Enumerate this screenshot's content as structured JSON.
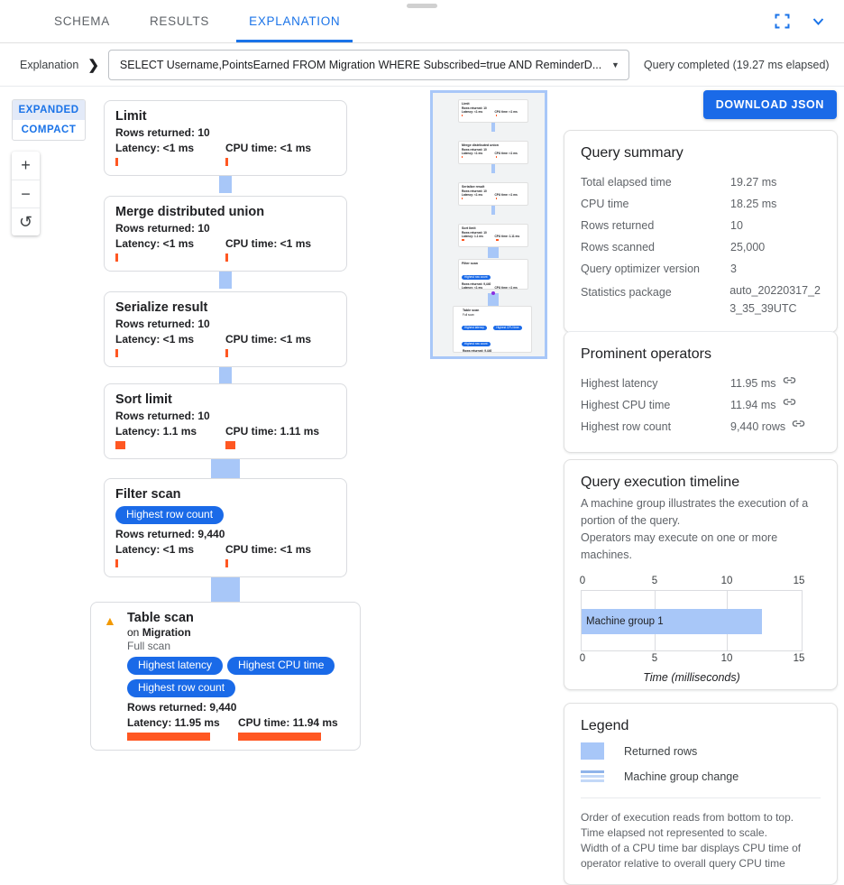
{
  "window": {
    "drag_handle": "drag-handle"
  },
  "tabs": [
    {
      "label": "SCHEMA",
      "active": false
    },
    {
      "label": "RESULTS",
      "active": false
    },
    {
      "label": "EXPLANATION",
      "active": true
    }
  ],
  "tabbar_actions": [
    {
      "name": "fullscreen-icon",
      "glyph": "fullscreen"
    },
    {
      "name": "chevron-down-icon",
      "glyph": "chevron-down"
    }
  ],
  "breadcrumb": {
    "label": "Explanation",
    "separator": "❯",
    "query": "SELECT Username,PointsEarned FROM Migration WHERE Subscribed=true AND ReminderD...",
    "caret": "▼",
    "status": "Query completed (19.27 ms elapsed)"
  },
  "view_mode": {
    "options": [
      {
        "label": "EXPANDED",
        "selected": true
      },
      {
        "label": "COMPACT",
        "selected": false
      }
    ]
  },
  "zoom_controls": [
    {
      "name": "zoom-in-button",
      "glyph": "+"
    },
    {
      "name": "zoom-out-button",
      "glyph": "−"
    },
    {
      "name": "reset-view-button",
      "glyph": "↺"
    }
  ],
  "download_button": {
    "label": "DOWNLOAD JSON"
  },
  "graph": {
    "nodes": [
      {
        "title": "Limit",
        "rows_label": "Rows returned: 10",
        "latency_label": "Latency: <1 ms",
        "cpu_label": "CPU time: <1 ms",
        "latency_bar_width": 3,
        "cpu_bar_width": 3,
        "badges": [],
        "warning": false
      },
      {
        "title": "Merge distributed union",
        "rows_label": "Rows returned: 10",
        "latency_label": "Latency: <1 ms",
        "cpu_label": "CPU time: <1 ms",
        "latency_bar_width": 3,
        "cpu_bar_width": 3,
        "badges": [],
        "warning": false
      },
      {
        "title": "Serialize result",
        "rows_label": "Rows returned: 10",
        "latency_label": "Latency: <1 ms",
        "cpu_label": "CPU time: <1 ms",
        "latency_bar_width": 3,
        "cpu_bar_width": 3,
        "badges": [],
        "warning": false
      },
      {
        "title": "Sort limit",
        "rows_label": "Rows returned: 10",
        "latency_label": "Latency: 1.1 ms",
        "cpu_label": "CPU time: 1.11 ms",
        "latency_bar_width": 11,
        "cpu_bar_width": 11,
        "badges": [],
        "warning": false
      },
      {
        "title": "Filter scan",
        "rows_label": "Rows returned: 9,440",
        "latency_label": "Latency: <1 ms",
        "cpu_label": "CPU time: <1 ms",
        "latency_bar_width": 3,
        "cpu_bar_width": 3,
        "badges": [
          "Highest row count"
        ],
        "warning": false
      },
      {
        "title": "Table scan",
        "subtitle_prefix": "on ",
        "subtitle_target": "Migration",
        "scan_type": "Full scan",
        "rows_label": "Rows returned: 9,440",
        "latency_label": "Latency: 11.95 ms",
        "cpu_label": "CPU time: 11.94 ms",
        "latency_bar_width": 92,
        "cpu_bar_width": 92,
        "badges": [
          "Highest latency",
          "Highest CPU time",
          "Highest row count"
        ],
        "warning": true
      }
    ],
    "edges": [
      {
        "from": "Limit",
        "to": "Merge distributed union",
        "width": 14,
        "machine_group_change": false
      },
      {
        "from": "Merge distributed union",
        "to": "Serialize result",
        "width": 14,
        "machine_group_change": false
      },
      {
        "from": "Serialize result",
        "to": "Sort limit",
        "width": 14,
        "machine_group_change": false
      },
      {
        "from": "Sort limit",
        "to": "Filter scan",
        "width": 32,
        "machine_group_change": true
      },
      {
        "from": "Filter scan",
        "to": "Table scan",
        "width": 32,
        "machine_group_change": true
      }
    ]
  },
  "query_summary": {
    "title": "Query summary",
    "rows": [
      {
        "key": "Total elapsed time",
        "value": "19.27 ms"
      },
      {
        "key": "CPU time",
        "value": "18.25 ms"
      },
      {
        "key": "Rows returned",
        "value": "10"
      },
      {
        "key": "Rows scanned",
        "value": "25,000"
      },
      {
        "key": "Query optimizer version",
        "value": "3"
      },
      {
        "key": "Statistics package",
        "value": "auto_20220317_2\n3_35_39UTC"
      }
    ]
  },
  "prominent_operators": {
    "title": "Prominent operators",
    "rows": [
      {
        "key": "Highest latency",
        "value": "11.95 ms",
        "icon": "link-icon"
      },
      {
        "key": "Highest CPU time",
        "value": "11.94 ms",
        "icon": "link-icon"
      },
      {
        "key": "Highest row count",
        "value": "9,440 rows",
        "icon": "link-icon"
      }
    ]
  },
  "timeline": {
    "title": "Query execution timeline",
    "description": "A machine group illustrates the execution of a portion of the query.\nOperators may execute on one or more machines.",
    "xlabel": "Time (milliseconds)"
  },
  "legend": {
    "title": "Legend",
    "items": [
      {
        "label": "Returned rows",
        "swatch": "returned-rows-swatch"
      },
      {
        "label": "Machine group change",
        "swatch": "machine-group-change-swatch"
      }
    ],
    "note": "Order of execution reads from bottom to top.\nTime elapsed not represented to scale.\nWidth of a CPU time bar displays CPU time of\noperator relative to overall query CPU time"
  },
  "chart_data": {
    "type": "bar",
    "title": "Query execution timeline",
    "orientation": "horizontal",
    "categories": [
      "Machine group 1"
    ],
    "values": [
      12.3
    ],
    "xlabel": "Time (milliseconds)",
    "ylabel": "",
    "xlim": [
      0,
      15
    ],
    "xticks": [
      0,
      5,
      10,
      15
    ],
    "xtick_labels": [
      "0",
      "5",
      "10",
      "15"
    ],
    "grid": true,
    "legend": "none",
    "bar_color": "#a8c7f8"
  }
}
